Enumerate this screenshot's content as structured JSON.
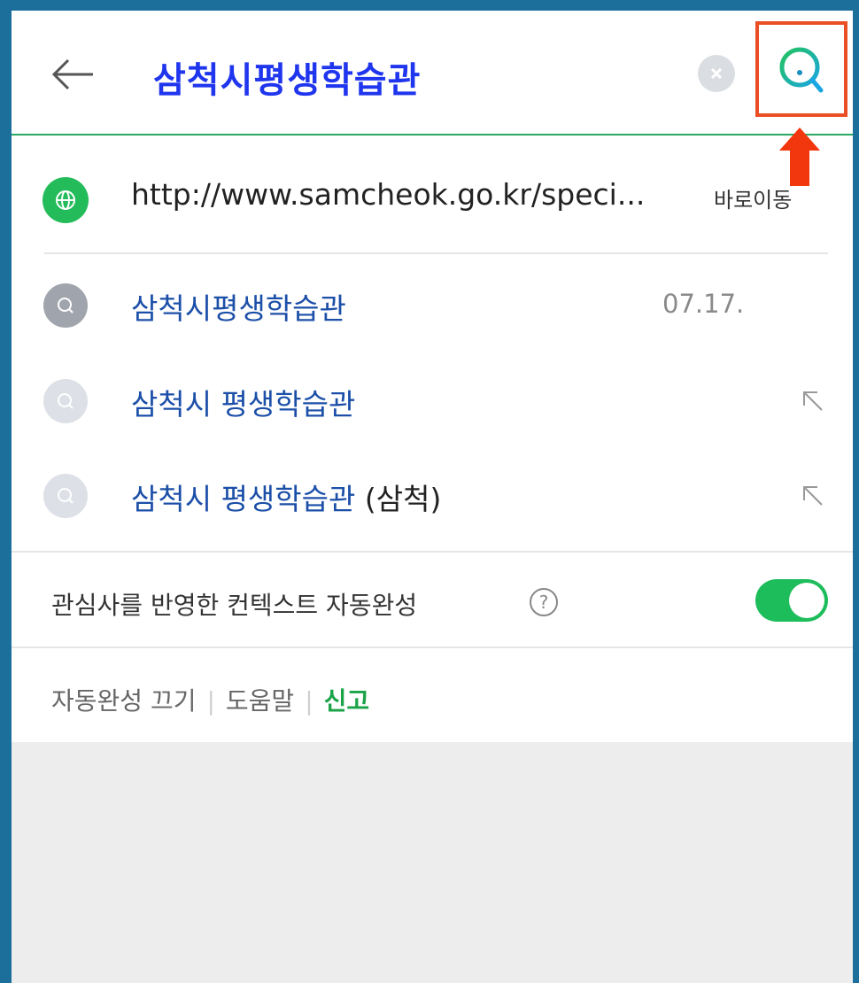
{
  "search": {
    "query": "삼척시평생학습관"
  },
  "url_suggestion": {
    "url": "http://www.samcheok.go.kr/speci...",
    "goto_label": "바로이동"
  },
  "suggestions": [
    {
      "text": "삼척시평생학습관",
      "extra": "",
      "date": "07.17."
    },
    {
      "text": "삼척시 평생학습관",
      "extra": "",
      "date": ""
    },
    {
      "text": "삼척시 평생학습관",
      "extra": " (삼척)",
      "date": ""
    }
  ],
  "context_autocomplete": {
    "label": "관심사를 반영한 컨텍스트 자동완성",
    "help": "?",
    "enabled": true
  },
  "footer": {
    "off_label": "자동완성 끄기",
    "help_label": "도움말",
    "report_label": "신고"
  },
  "colors": {
    "query": "#1f35ee",
    "accent_green": "#1dbd5b",
    "highlight_box": "#ea4e25",
    "link_blue": "#1c4fa8"
  },
  "icons": [
    "back-arrow-icon",
    "clear-icon",
    "search-icon",
    "globe-icon",
    "history-search-icon",
    "search-suggestion-icon",
    "fill-arrow-icon",
    "help-icon"
  ]
}
